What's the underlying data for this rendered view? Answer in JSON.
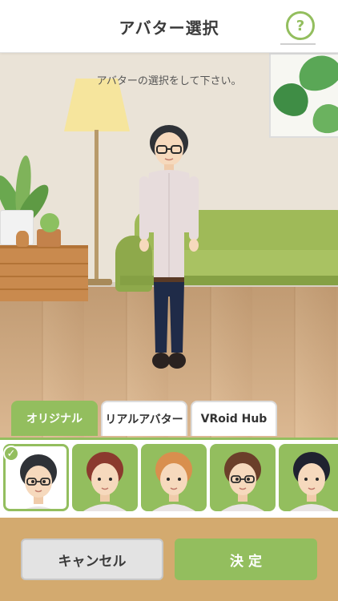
{
  "header": {
    "title": "アバター選択",
    "help_label": "?"
  },
  "scene": {
    "instruction": "アバターの選択をして下さい。"
  },
  "tabs": [
    {
      "label": "オリジナル",
      "active": true
    },
    {
      "label": "リアルアバター",
      "active": false
    },
    {
      "label": "VRoid Hub",
      "active": false
    }
  ],
  "avatars": [
    {
      "hair": "#2f3237",
      "skin": "#f6d9bd",
      "glasses": true,
      "selected": true
    },
    {
      "hair": "#8b3a2e",
      "skin": "#f6d9bd",
      "glasses": false,
      "selected": false
    },
    {
      "hair": "#d98f4e",
      "skin": "#f6d9bd",
      "glasses": false,
      "selected": false
    },
    {
      "hair": "#6b3f2a",
      "skin": "#f6d9bd",
      "glasses": true,
      "selected": false
    },
    {
      "hair": "#1f2230",
      "skin": "#f6d9bd",
      "glasses": false,
      "selected": false
    }
  ],
  "footer": {
    "cancel_label": "キャンセル",
    "ok_label": "決 定"
  },
  "colors": {
    "accent": "#93be5e",
    "footer_bg": "#d3aa6f"
  }
}
